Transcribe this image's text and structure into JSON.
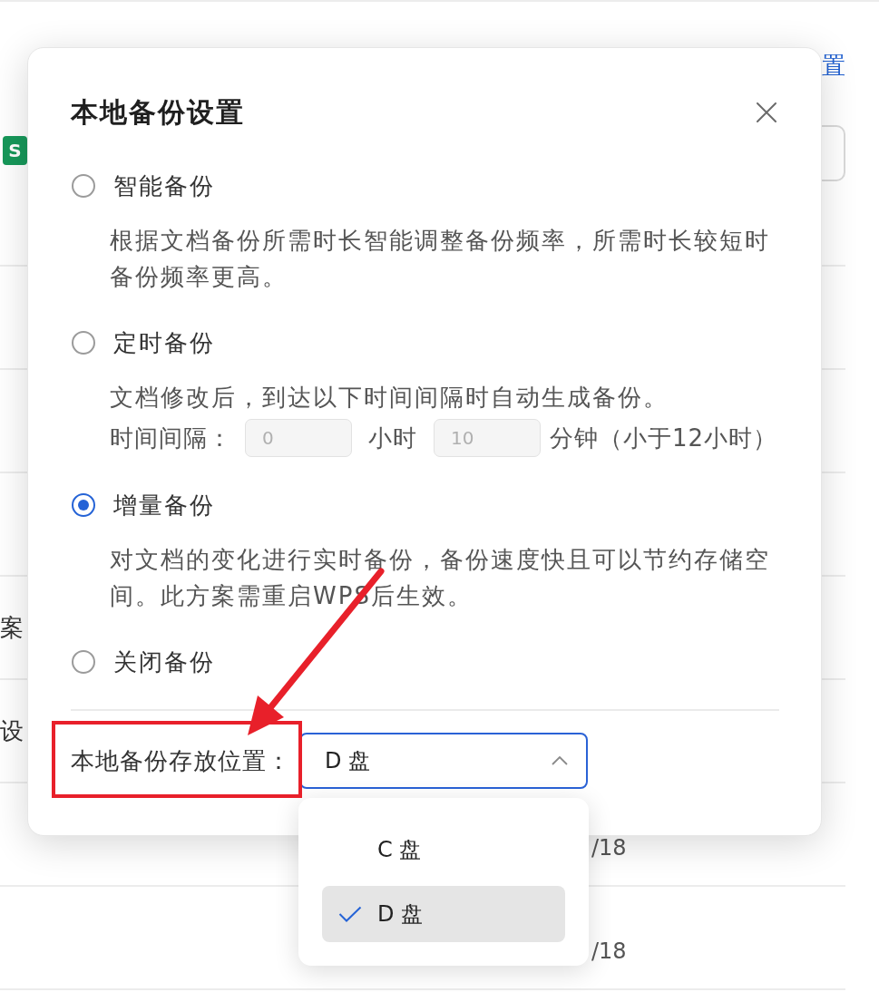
{
  "background": {
    "link": "置",
    "app_icon": "S",
    "rows": [
      {
        "column_1": "案"
      },
      {
        "column_1": "设"
      },
      {
        "column_2": "/18"
      },
      {
        "column_2": "/18"
      }
    ]
  },
  "dialog": {
    "title": "本地备份设置",
    "options": [
      {
        "label": "智能备份",
        "selected": false,
        "description": "根据文档备份所需时长智能调整备份频率，所需时长较短时备份频率更高。"
      },
      {
        "label": "定时备份",
        "selected": false,
        "description": "文档修改后，到达以下时间间隔时自动生成备份。",
        "interval": {
          "label": "时间间隔：",
          "hours": {
            "value": "0",
            "disabled": true
          },
          "hours_unit": "小时",
          "minutes": {
            "value": "10",
            "disabled": true
          },
          "minutes_unit": "分钟（小于12小时）"
        }
      },
      {
        "label": "增量备份",
        "selected": true,
        "description": "对文档的变化进行实时备份，备份速度快且可以节约存储空间。此方案需重启WPS后生效。"
      },
      {
        "label": "关闭备份",
        "selected": false
      }
    ],
    "location": {
      "label": "本地备份存放位置：",
      "value": "D 盘",
      "expanded": true,
      "options": [
        {
          "label": "C 盘",
          "selected": false
        },
        {
          "label": "D 盘",
          "selected": true
        }
      ]
    }
  }
}
